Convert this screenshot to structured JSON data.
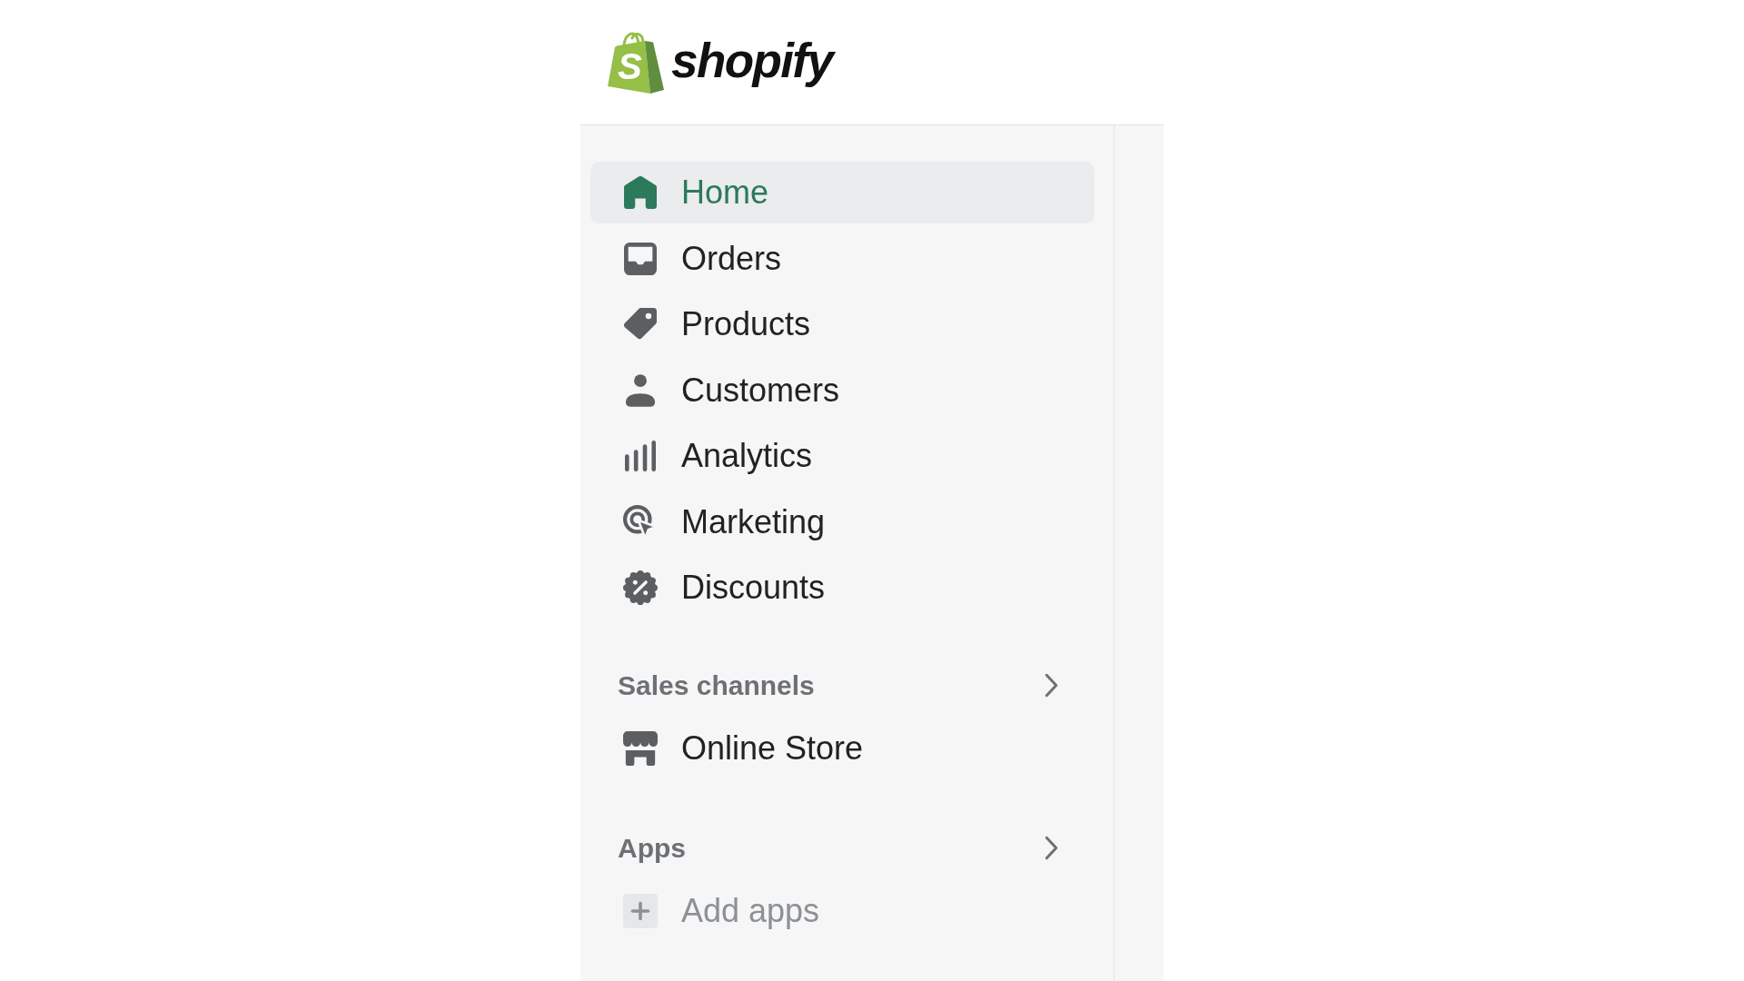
{
  "header": {
    "logo": {
      "mark_letter": "S",
      "wordmark": "shopify"
    }
  },
  "nav": {
    "items": [
      {
        "label": "Home",
        "selected": true
      },
      {
        "label": "Orders",
        "selected": false
      },
      {
        "label": "Products",
        "selected": false
      },
      {
        "label": "Customers",
        "selected": false
      },
      {
        "label": "Analytics",
        "selected": false
      },
      {
        "label": "Marketing",
        "selected": false
      },
      {
        "label": "Discounts",
        "selected": false
      }
    ]
  },
  "sections": [
    {
      "title": "Sales channels",
      "items": [
        {
          "label": "Online Store",
          "kind": "link",
          "selected": false
        }
      ]
    },
    {
      "title": "Apps",
      "items": [
        {
          "label": "Add apps",
          "kind": "add"
        }
      ]
    }
  ]
}
